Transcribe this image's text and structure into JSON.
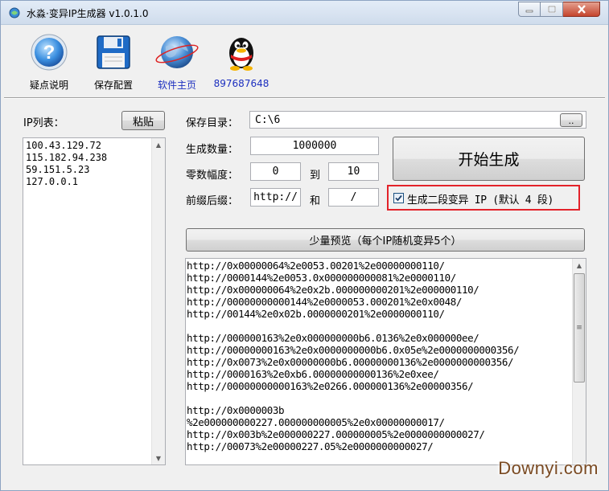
{
  "window": {
    "title": "水淼·变异IP生成器 v1.0.1.0"
  },
  "toolbar": {
    "items": [
      {
        "label": "疑点说明",
        "icon": "help-icon"
      },
      {
        "label": "保存配置",
        "icon": "save-icon"
      },
      {
        "label": "软件主页",
        "icon": "globe-icon"
      },
      {
        "label": "897687648",
        "icon": "qq-penguin-icon"
      }
    ]
  },
  "left": {
    "ip_list_label": "IP列表：",
    "paste_label": "粘贴",
    "ip_list": [
      "100.43.129.72",
      "115.182.94.238",
      "59.151.5.23",
      "127.0.0.1"
    ]
  },
  "form": {
    "save_dir_label": "保存目录：",
    "save_dir_value": "C:\\6",
    "browse_label": "..",
    "count_label": "生成数量：",
    "count_value": "1000000",
    "zero_label": "零数幅度：",
    "zero_from": "0",
    "zero_to_label": "到",
    "zero_to": "10",
    "affix_label": "前缀后缀：",
    "prefix_value": "http://",
    "and_label": "和",
    "suffix_value": "/",
    "start_label": "开始生成",
    "checkbox_label": "生成二段变异 IP (默认 4 段)",
    "checkbox_checked": true,
    "preview_label": "少量预览（每个IP随机变异5个）"
  },
  "output": {
    "lines": [
      "http://0x00000064%2e0053.00201%2e00000000110/",
      "http://0000144%2e0053.0x000000000081%2e0000110/",
      "http://0x000000064%2e0x2b.000000000201%2e000000110/",
      "http://00000000000144%2e0000053.000201%2e0x0048/",
      "http://00144%2e0x02b.0000000201%2e0000000110/",
      "",
      "http://000000163%2e0x000000000b6.0136%2e0x000000ee/",
      "http://00000000163%2e0x0000000000b6.0x05e%2e0000000000356/",
      "http://0x0073%2e0x00000000b6.00000000136%2e0000000000356/",
      "http://0000163%2e0xb6.00000000000136%2e0xee/",
      "http://00000000000163%2e0266.000000136%2e00000356/",
      "",
      "http://0x0000003b",
      "%2e000000000227.000000000005%2e0x00000000017/",
      "http://0x003b%2e000000227.000000005%2e0000000000027/",
      "http://00073%2e00000227.05%2e0000000000027/"
    ]
  },
  "watermark": "Downyi.com",
  "colors": {
    "highlight_border": "#e3222a",
    "link_text": "#1c2fbf"
  }
}
